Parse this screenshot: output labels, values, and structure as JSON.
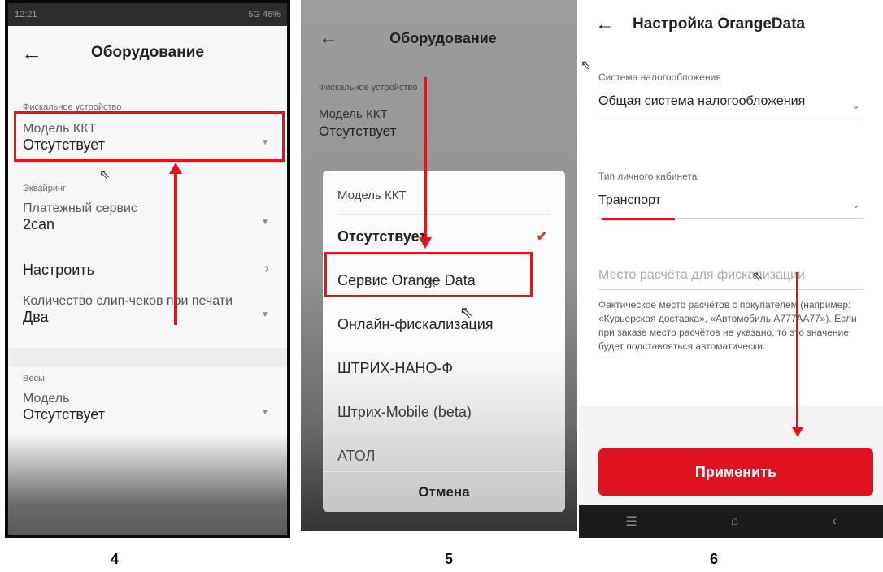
{
  "panel4": {
    "status_time": "12:21",
    "status_icons": "5G 46%",
    "title": "Оборудование",
    "fiscal_section": "Фискальное устройство",
    "kkt_label": "Модель ККТ",
    "kkt_value": "Отсутствует",
    "acquiring_section": "Эквайринг",
    "payment_label": "Платежный сервис",
    "payment_value": "2can",
    "configure_label": "Настроить",
    "slips_label": "Количество слип-чеков при печати",
    "slips_value": "Два",
    "scales_section": "Весы",
    "scales_label": "Модель",
    "scales_value": "Отсутствует",
    "step": "4"
  },
  "panel5": {
    "title": "Оборудование",
    "bg_fiscal_section": "Фискальное устройство",
    "bg_kkt_label": "Модель ККТ",
    "bg_kkt_value": "Отсутствует",
    "dialog_title": "Модель ККТ",
    "options": [
      "Отсутствует",
      "Сервис Orange Data",
      "Онлайн-фискализация",
      "ШТРИХ-НАНО-Ф",
      "Штрих-Mobile (beta)",
      "АТОЛ"
    ],
    "selected_option": "Отсутствует",
    "cancel_label": "Отмена",
    "step": "5"
  },
  "panel6": {
    "title": "Настройка OrangeData",
    "tax_label": "Система налогообложения",
    "tax_value": "Общая система налогообложения",
    "cabinet_label": "Тип личного кабинета",
    "cabinet_value": "Транспорт",
    "place_placeholder": "Место расчёта для фискализации",
    "place_helper": "Фактическое место расчётов с покупателем (например: «Курьерская доставка», «Автомобиль А777АА77»). Если при заказе место расчётов не указано, то это значение будет подставляться автоматически.",
    "apply_label": "Применить",
    "step": "6"
  },
  "colors": {
    "accent_red": "#e4121c",
    "button_red": "#e0121f"
  }
}
